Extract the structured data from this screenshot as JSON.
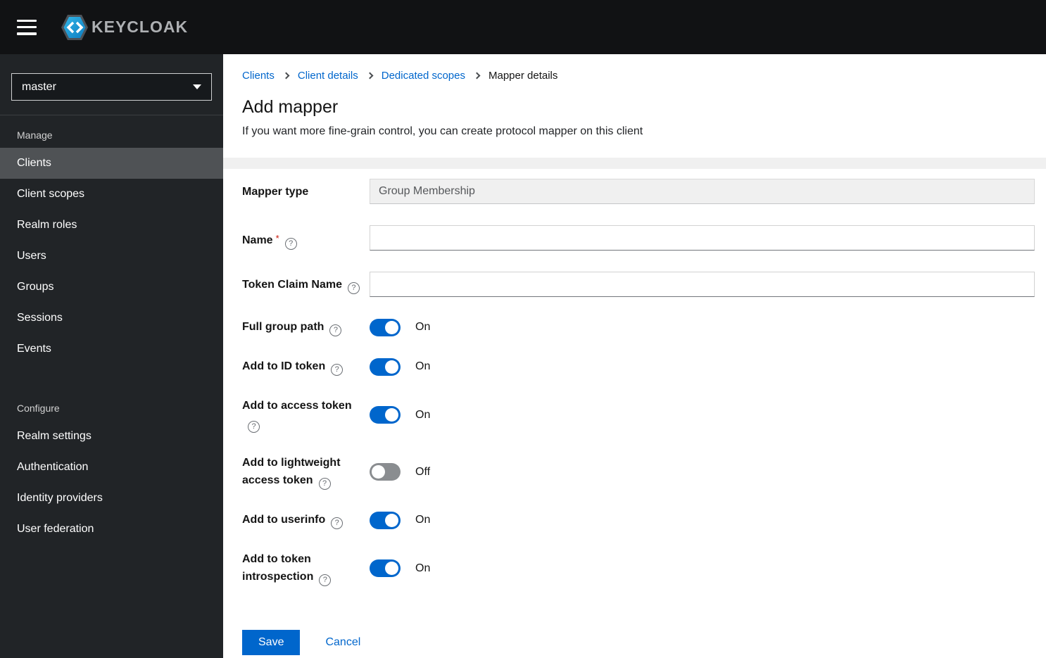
{
  "topbar": {
    "brand": "KEYCLOAK"
  },
  "sidebar": {
    "realm": "master",
    "sections": [
      {
        "heading": "Manage",
        "items": [
          {
            "label": "Clients"
          },
          {
            "label": "Client scopes"
          },
          {
            "label": "Realm roles"
          },
          {
            "label": "Users"
          },
          {
            "label": "Groups"
          },
          {
            "label": "Sessions"
          },
          {
            "label": "Events"
          }
        ]
      },
      {
        "heading": "Configure",
        "items": [
          {
            "label": "Realm settings"
          },
          {
            "label": "Authentication"
          },
          {
            "label": "Identity providers"
          },
          {
            "label": "User federation"
          }
        ]
      }
    ]
  },
  "breadcrumb": {
    "links": [
      "Clients",
      "Client details",
      "Dedicated scopes"
    ],
    "current": "Mapper details"
  },
  "header": {
    "title": "Add mapper",
    "subtitle": "If you want more fine-grain control, you can create protocol mapper on this client"
  },
  "form": {
    "mapper_type": {
      "label": "Mapper type",
      "value": "Group Membership"
    },
    "name": {
      "label": "Name",
      "required_marker": "*",
      "value": ""
    },
    "token_claim_name": {
      "label": "Token Claim Name",
      "value": ""
    },
    "help_glyph": "?",
    "toggles": [
      {
        "label": "Full group path",
        "state": "On"
      },
      {
        "label": "Add to ID token",
        "state": "On"
      },
      {
        "label": "Add to access token",
        "state": "On"
      },
      {
        "label": "Add to lightweight access token",
        "state": "Off"
      },
      {
        "label": "Add to userinfo",
        "state": "On"
      },
      {
        "label": "Add to token introspection",
        "state": "On"
      }
    ],
    "actions": {
      "save": "Save",
      "cancel": "Cancel"
    }
  },
  "colors": {
    "accent": "#0066cc",
    "toggle_off": "#8a8d90",
    "required": "#c9190b",
    "brand_icon_blue": "#1fa8e0",
    "sidebar_bg": "#212427",
    "topbar_bg": "#111214"
  }
}
